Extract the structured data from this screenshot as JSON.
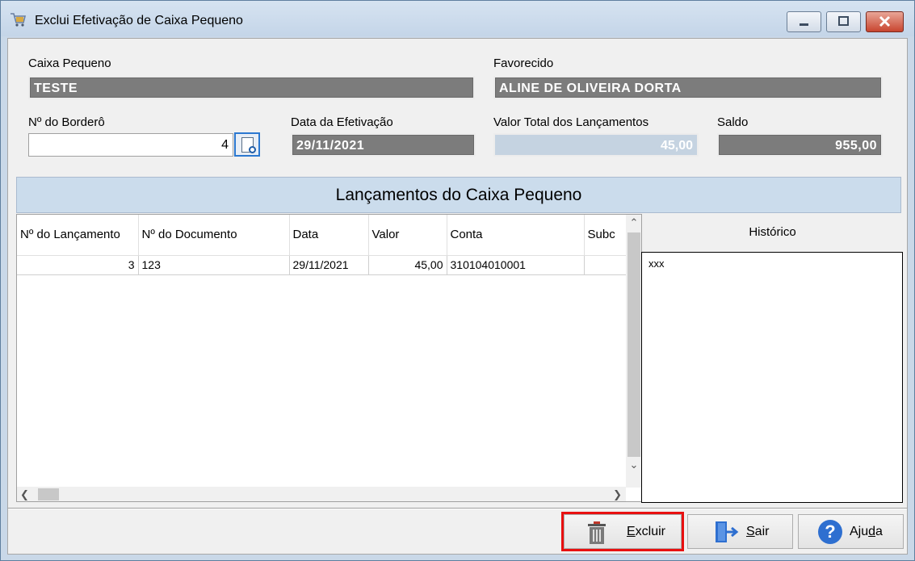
{
  "window": {
    "title": "Exclui Efetivação de Caixa Pequeno"
  },
  "form": {
    "caixa_label": "Caixa Pequeno",
    "caixa_value": "TESTE",
    "favorecido_label": "Favorecido",
    "favorecido_value": "ALINE DE OLIVEIRA DORTA",
    "bordero_label": "Nº do Borderô",
    "bordero_value": "4",
    "data_label": "Data da Efetivação",
    "data_value": "29/11/2021",
    "valor_total_label": "Valor Total dos Lançamentos",
    "valor_total_value": "45,00",
    "saldo_label": "Saldo",
    "saldo_value": "955,00"
  },
  "section": {
    "title": "Lançamentos do Caixa Pequeno"
  },
  "grid": {
    "columns": [
      "Nº do Lançamento",
      "Nº do Documento",
      "Data",
      "Valor",
      "Conta",
      "Subc"
    ],
    "rows": [
      [
        "3",
        "123",
        "29/11/2021",
        "45,00",
        "310104010001",
        ""
      ]
    ]
  },
  "historico": {
    "title": "Histórico",
    "text": "xxx"
  },
  "buttons": {
    "excluir_u": "E",
    "excluir_rest": "xcluir",
    "sair_u": "S",
    "sair_rest": "air",
    "ajuda_pre": "Aju",
    "ajuda_u": "d",
    "ajuda_post": "a"
  },
  "colors": {
    "accent_highlight": "#e81010",
    "readonly_field": "#7c7c7c",
    "section_header": "#cbdcec"
  },
  "icons": {
    "title": "cart-icon",
    "lookup": "search-document-icon",
    "excluir": "trash-icon",
    "sair": "exit-door-icon",
    "ajuda": "help-icon"
  }
}
